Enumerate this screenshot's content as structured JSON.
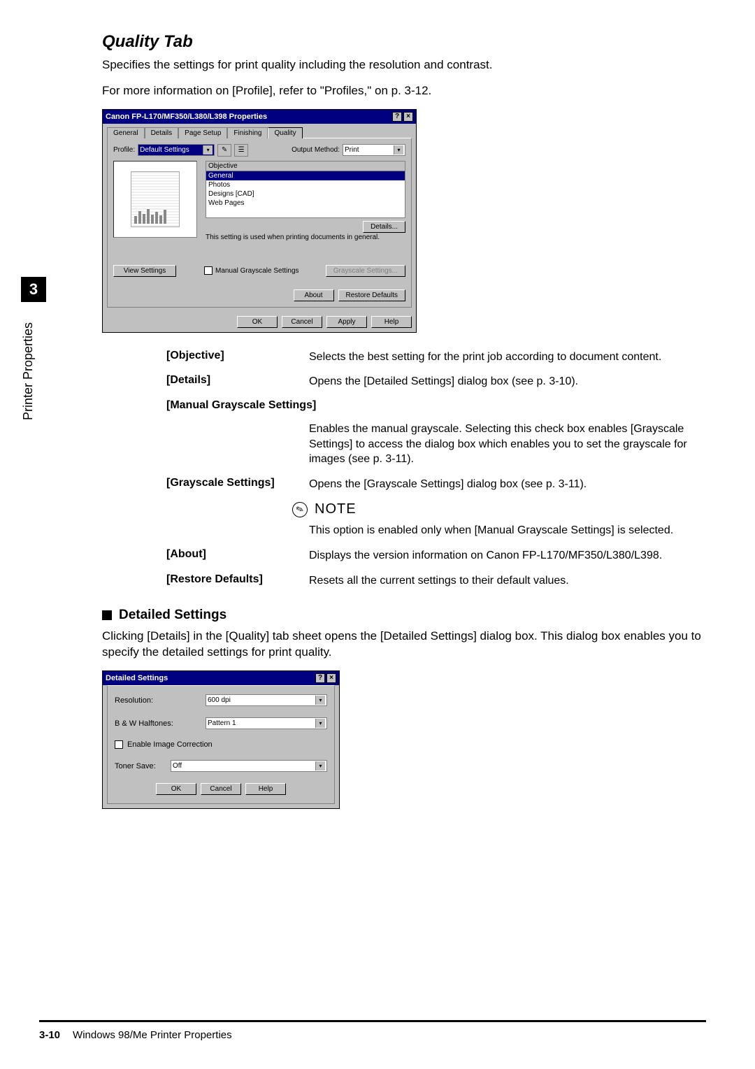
{
  "section_title": "Quality Tab",
  "intro1": "Specifies the settings for print quality including the resolution and contrast.",
  "intro2": "For more information on [Profile], refer to \"Profiles,\" on p. 3-12.",
  "side": {
    "chapter_num": "3",
    "side_label": "Printer Properties"
  },
  "dialog1": {
    "title": "Canon FP-L170/MF350/L380/L398 Properties",
    "tabs": [
      "General",
      "Details",
      "Page Setup",
      "Finishing",
      "Quality"
    ],
    "active_tab": "Quality",
    "profile_label": "Profile:",
    "profile_value": "Default Settings",
    "output_label": "Output Method:",
    "output_value": "Print",
    "objective_group": "Objective",
    "objective_items": [
      "General",
      "Photos",
      "Designs [CAD]",
      "Web Pages"
    ],
    "objective_selected": "General",
    "details_btn": "Details...",
    "hint": "This setting is used when printing documents in general.",
    "view_settings": "View Settings",
    "manual_gray_label": "Manual Grayscale Settings",
    "grayscale_btn": "Grayscale Settings...",
    "about_btn": "About",
    "restore_btn": "Restore Defaults",
    "ok": "OK",
    "cancel": "Cancel",
    "apply": "Apply",
    "help": "Help"
  },
  "defs": {
    "objective_label": "[Objective]",
    "objective_text": "Selects the best setting for the print job according to document content.",
    "details_label": "[Details]",
    "details_text": "Opens the [Detailed Settings] dialog box (see p. 3-10).",
    "manual_label": "[Manual Grayscale Settings]",
    "manual_text": "Enables the manual grayscale. Selecting this check box enables [Grayscale Settings] to access the dialog box which enables you to set the grayscale for images (see p. 3-11).",
    "gray_label": "[Grayscale Settings]",
    "gray_text": "Opens the [Grayscale Settings] dialog box (see p. 3-11).",
    "note_word": "NOTE",
    "note_text": "This option is enabled only when [Manual Grayscale Settings] is selected.",
    "about_label": "[About]",
    "about_text": "Displays the version information on Canon FP-L170/MF350/L380/L398.",
    "restore_label": "[Restore Defaults]",
    "restore_text": "Resets all the current settings to their default values."
  },
  "sub_heading": "Detailed Settings",
  "sub_text": "Clicking [Details] in the [Quality] tab sheet opens the [Detailed Settings] dialog box. This dialog box enables you to specify the detailed settings for print quality.",
  "dialog2": {
    "title": "Detailed Settings",
    "resolution_label": "Resolution:",
    "resolution_value": "600 dpi",
    "halftones_label": "B & W Halftones:",
    "halftones_value": "Pattern 1",
    "enable_img_label": "Enable Image Correction",
    "toner_label": "Toner Save:",
    "toner_value": "Off",
    "ok": "OK",
    "cancel": "Cancel",
    "help": "Help"
  },
  "footer": {
    "page_num": "3-10",
    "running": "Windows 98/Me Printer Properties"
  }
}
